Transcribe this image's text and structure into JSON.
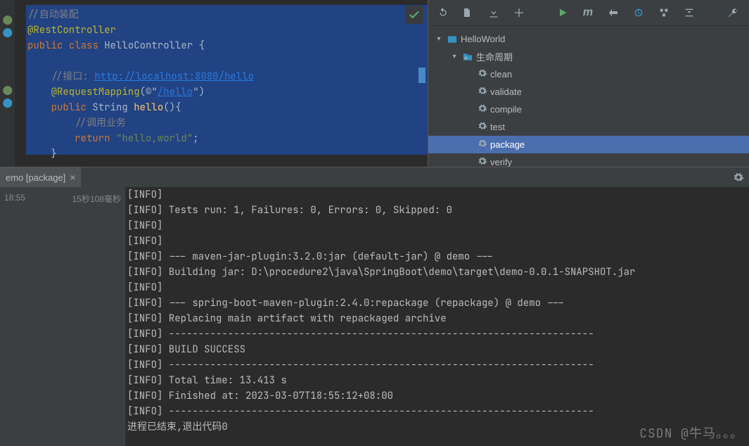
{
  "editor": {
    "check_ok": true,
    "lines": [
      {
        "segs": [
          {
            "cls": "c-comment",
            "t": "//自动装配"
          }
        ]
      },
      {
        "segs": [
          {
            "cls": "c-annotation",
            "t": "@RestController"
          }
        ]
      },
      {
        "segs": [
          {
            "cls": "c-keyword",
            "t": "public "
          },
          {
            "cls": "c-keyword",
            "t": "class "
          },
          {
            "cls": "c-class",
            "t": "HelloController "
          },
          {
            "cls": "c-plain",
            "t": "{"
          }
        ]
      },
      {
        "segs": [
          {
            "cls": "c-plain",
            "t": ""
          }
        ]
      },
      {
        "segs": [
          {
            "cls": "c-comment",
            "t": "    //接口: "
          },
          {
            "cls": "c-link",
            "t": "http://localhost:8080/hello"
          }
        ]
      },
      {
        "segs": [
          {
            "cls": "c-annotation",
            "t": "    @RequestMapping"
          },
          {
            "cls": "c-plain",
            "t": "(©\""
          },
          {
            "cls": "c-link",
            "t": "/hello"
          },
          {
            "cls": "c-plain",
            "t": "\")"
          }
        ]
      },
      {
        "segs": [
          {
            "cls": "c-keyword",
            "t": "    public "
          },
          {
            "cls": "c-class",
            "t": "String "
          },
          {
            "cls": "c-funcname",
            "t": "hello"
          },
          {
            "cls": "c-plain",
            "t": "(){"
          }
        ]
      },
      {
        "segs": [
          {
            "cls": "c-comment",
            "t": "        //调用业务"
          }
        ]
      },
      {
        "segs": [
          {
            "cls": "c-keyword",
            "t": "        return "
          },
          {
            "cls": "c-string",
            "t": "\"hello,world\""
          },
          {
            "cls": "c-plain",
            "t": ";"
          }
        ]
      },
      {
        "segs": [
          {
            "cls": "c-plain",
            "t": "    }"
          }
        ]
      }
    ]
  },
  "maven": {
    "project": "HelloWorld",
    "lifecycle_label": "生命周期",
    "goals": [
      {
        "label": "clean",
        "selected": false
      },
      {
        "label": "validate",
        "selected": false
      },
      {
        "label": "compile",
        "selected": false
      },
      {
        "label": "test",
        "selected": false
      },
      {
        "label": "package",
        "selected": true
      },
      {
        "label": "verify",
        "selected": false
      }
    ]
  },
  "run": {
    "tab_label": "emo [package]",
    "time_left": "18:55",
    "time_right": "15秒108毫秒",
    "lines": [
      "[INFO]",
      "[INFO] Tests run: 1, Failures: 0, Errors: 0, Skipped: 0",
      "[INFO]",
      "[INFO]",
      "[INFO] --- maven-jar-plugin:3.2.0:jar (default-jar) @ demo ---",
      "[INFO] Building jar: D:\\procedure2\\java\\SpringBoot\\demo\\target\\demo-0.0.1-SNAPSHOT.jar",
      "[INFO]",
      "[INFO] --- spring-boot-maven-plugin:2.4.0:repackage (repackage) @ demo ---",
      "[INFO] Replacing main artifact with repackaged archive",
      "[INFO] ------------------------------------------------------------------------",
      "[INFO] BUILD SUCCESS",
      "[INFO] ------------------------------------------------------------------------",
      "[INFO] Total time:  13.413 s",
      "[INFO] Finished at: 2023-03-07T18:55:12+08:00",
      "[INFO] ------------------------------------------------------------------------",
      "",
      "进程已结束,退出代码0"
    ]
  },
  "watermark": "CSDN @牛马。。。"
}
